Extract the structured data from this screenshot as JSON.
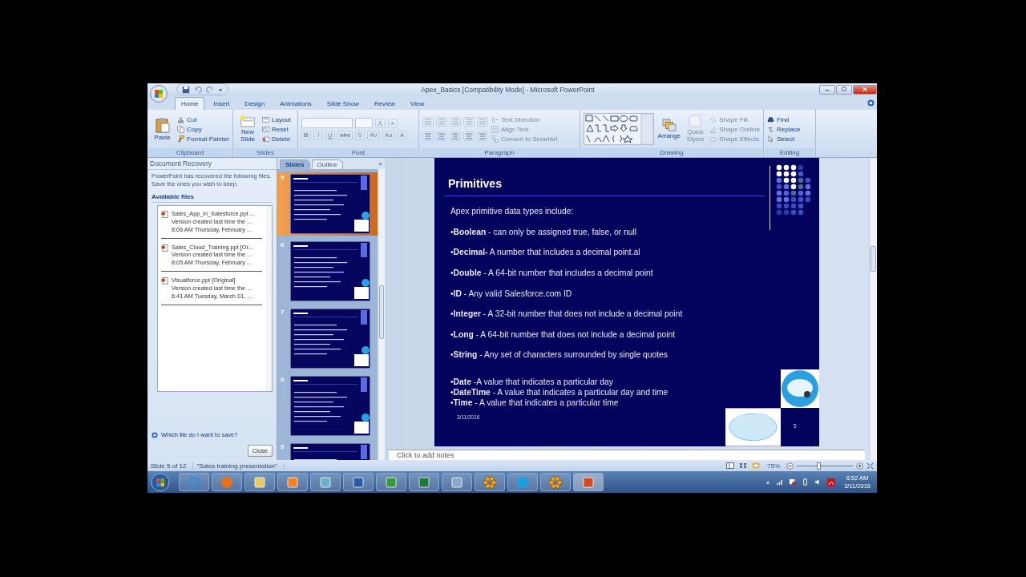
{
  "window": {
    "title": "Apex_Basics [Compatibility Mode] - Microsoft PowerPoint"
  },
  "tabs": [
    {
      "label": "Home",
      "selected": true
    },
    {
      "label": "Insert",
      "selected": false
    },
    {
      "label": "Design",
      "selected": false
    },
    {
      "label": "Animations",
      "selected": false
    },
    {
      "label": "Slide Show",
      "selected": false
    },
    {
      "label": "Review",
      "selected": false
    },
    {
      "label": "View",
      "selected": false
    }
  ],
  "ribbon": {
    "clipboard": {
      "label": "Clipboard",
      "paste": "Paste",
      "items": [
        {
          "kind": "cut",
          "label": "Cut"
        },
        {
          "kind": "copy",
          "label": "Copy"
        },
        {
          "kind": "painter",
          "label": "Format Painter"
        }
      ]
    },
    "slides": {
      "label": "Slides",
      "new_slide": "New Slide",
      "items": [
        {
          "kind": "layout",
          "label": "Layout"
        },
        {
          "kind": "reset",
          "label": "Reset"
        },
        {
          "kind": "delete",
          "label": "Delete"
        }
      ]
    },
    "font": {
      "label": "Font",
      "buttons": [
        {
          "kind": "grow",
          "label": "A",
          "disabled": true
        },
        {
          "kind": "shrink",
          "label": "A",
          "disabled": true
        },
        {
          "kind": "bold",
          "label": "B",
          "disabled": true
        },
        {
          "kind": "italic",
          "label": "I",
          "disabled": true
        },
        {
          "kind": "underline",
          "label": "U",
          "disabled": true
        },
        {
          "kind": "strike",
          "label": "abc",
          "disabled": true
        },
        {
          "kind": "shadow",
          "label": "S",
          "disabled": true
        },
        {
          "kind": "spacing",
          "label": "AV",
          "disabled": true
        },
        {
          "kind": "case",
          "label": "Aa",
          "disabled": true
        },
        {
          "kind": "color",
          "label": "A",
          "disabled": true
        }
      ]
    },
    "paragraph": {
      "label": "Paragraph",
      "items": [
        {
          "kind": "direction",
          "label": "Text Direction",
          "disabled": true
        },
        {
          "kind": "align",
          "label": "Align Text",
          "disabled": true
        },
        {
          "kind": "smartart",
          "label": "Convert to SmartArt",
          "disabled": true
        }
      ]
    },
    "drawing": {
      "label": "Drawing",
      "arrange": "Arrange",
      "quick_styles": {
        "label": "Quick Styles",
        "disabled": true
      },
      "items": [
        {
          "kind": "fill",
          "label": "Shape Fill",
          "disabled": true
        },
        {
          "kind": "outline",
          "label": "Shape Outline",
          "disabled": true
        },
        {
          "kind": "effects",
          "label": "Shape Effects",
          "disabled": true
        }
      ]
    },
    "editing": {
      "label": "Editing",
      "items": [
        {
          "kind": "find",
          "label": "Find"
        },
        {
          "kind": "replace",
          "label": "Replace"
        },
        {
          "kind": "select",
          "label": "Select"
        }
      ]
    }
  },
  "recovery": {
    "title": "Document Recovery",
    "message": "PowerPoint has recovered the following files. Save the ones you wish to keep.",
    "heading": "Available files",
    "files": [
      {
        "name": "Sales_App_in_Salesforce.ppt ...",
        "detail": "Version created last time the ...",
        "time": "8:06 AM Thursday, February ..."
      },
      {
        "name": "Sales_Cloud_Training.ppt [Or...",
        "detail": "Version created last time the ...",
        "time": "8:05 AM Thursday, February ..."
      },
      {
        "name": "Visualforce.ppt [Original]",
        "detail": "Version created last time the ...",
        "time": "6:41 AM Tuesday, March 01, ..."
      }
    ],
    "help": "Which file do I want to save?",
    "close": "Close"
  },
  "slides_pane": {
    "tabs": [
      {
        "label": "Slides",
        "selected": true
      },
      {
        "label": "Outline",
        "selected": false
      }
    ],
    "close": "×",
    "thumbnails": [
      {
        "number": "5",
        "selected": true
      },
      {
        "number": "6",
        "selected": false
      },
      {
        "number": "7",
        "selected": false
      },
      {
        "number": "8",
        "selected": false
      },
      {
        "number": "9",
        "selected": false
      }
    ]
  },
  "slide": {
    "title": "Primitives",
    "intro": "Apex primitive data types include:",
    "items": [
      "•**Boolean** - can only be assigned true, false, or null",
      "•**Decimal-** A number that includes a decimal point.al",
      "•**Double** - A 64-bit number that includes a decimal point",
      "•**ID**  - Any valid Salesforce.com ID",
      "•**Integer** -  A 32-bit number that does not include a decimal point",
      "•**Long** - A 64-bit number that does not include a decimal point",
      "•**String** -  Any set of characters surrounded by single quotes"
    ],
    "compact_items": [
      "•**Date** -A value that indicates a particular day",
      "•**DateTime** - A value that indicates a particular day and time",
      "•**Time** -  A value that indicates a particular time"
    ],
    "date": "3/11/2016",
    "page": "5"
  },
  "notes": {
    "placeholder": "Click to add notes"
  },
  "status_bar": {
    "slide": "Slide 5 of 12",
    "theme": "\"Sales training presentation\"",
    "zoom": "75%",
    "zoom_slider": {
      "level": 0.38
    }
  },
  "taskbar": {
    "time": "6:52 AM",
    "date": "3/11/2016"
  }
}
